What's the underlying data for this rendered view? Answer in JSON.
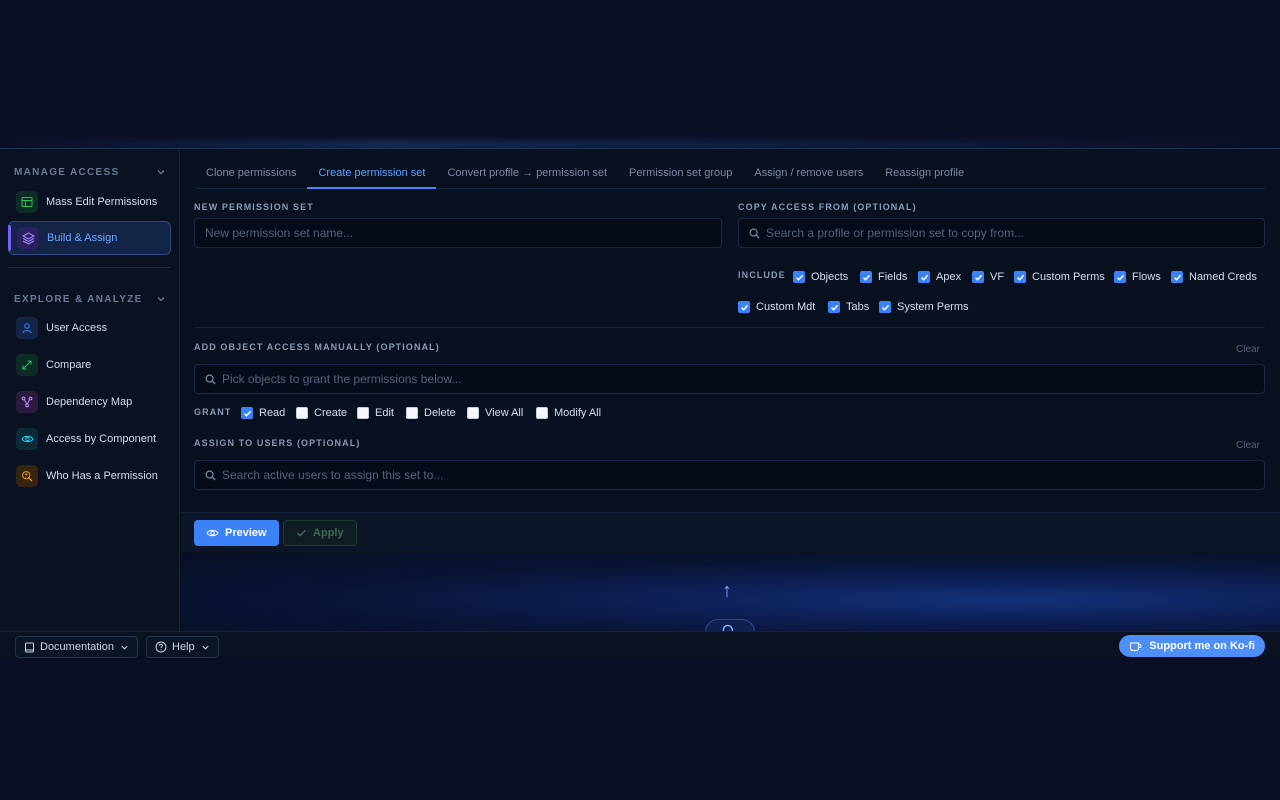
{
  "sidebar": {
    "manage_access_title": "MANAGE ACCESS",
    "explore_title": "EXPLORE & ANALYZE",
    "items": [
      {
        "label": "Mass Edit Permissions",
        "icon": "table-icon",
        "color": "#22c55e"
      },
      {
        "label": "Build & Assign",
        "icon": "layers-icon",
        "color": "#a78bfa"
      },
      {
        "label": "User Access",
        "icon": "user-icon",
        "color": "#3b82f6"
      },
      {
        "label": "Compare",
        "icon": "compare-arrows-icon",
        "color": "#22c55e"
      },
      {
        "label": "Dependency Map",
        "icon": "graph-icon",
        "color": "#c084fc"
      },
      {
        "label": "Access by Component",
        "icon": "eye-icon",
        "color": "#22d3ee"
      },
      {
        "label": "Who Has a Permission",
        "icon": "search-person-icon",
        "color": "#f59e0b"
      }
    ]
  },
  "tabs": [
    {
      "label": "Clone permissions"
    },
    {
      "label": "Create permission set"
    },
    {
      "label": "Convert profile → permission set"
    },
    {
      "label": "Permission set group"
    },
    {
      "label": "Assign / remove users"
    },
    {
      "label": "Reassign profile"
    }
  ],
  "form": {
    "new_set_label": "NEW PERMISSION SET",
    "new_set_placeholder": "New permission set name...",
    "copy_label": "COPY ACCESS FROM (OPTIONAL)",
    "copy_placeholder": "Search a profile or permission set to copy from...",
    "include_label": "INCLUDE",
    "include_options": [
      {
        "label": "Objects",
        "checked": true
      },
      {
        "label": "Fields",
        "checked": true
      },
      {
        "label": "Apex",
        "checked": true
      },
      {
        "label": "VF",
        "checked": true
      },
      {
        "label": "Custom Perms",
        "checked": true
      },
      {
        "label": "Flows",
        "checked": true
      },
      {
        "label": "Named Creds",
        "checked": true
      },
      {
        "label": "Custom Mdt",
        "checked": true
      },
      {
        "label": "Tabs",
        "checked": true
      },
      {
        "label": "System Perms",
        "checked": true
      }
    ],
    "object_access_label": "ADD OBJECT ACCESS MANUALLY (OPTIONAL)",
    "object_placeholder": "Pick objects to grant the permissions below...",
    "clear": "Clear",
    "grant_label": "GRANT",
    "grant_options": [
      {
        "label": "Read",
        "checked": true
      },
      {
        "label": "Create",
        "checked": false
      },
      {
        "label": "Edit",
        "checked": false
      },
      {
        "label": "Delete",
        "checked": false
      },
      {
        "label": "View All",
        "checked": false
      },
      {
        "label": "Modify All",
        "checked": false
      }
    ],
    "assign_label": "ASSIGN TO USERS (OPTIONAL)",
    "assign_placeholder": "Search active users to assign this set to..."
  },
  "actions": {
    "preview": "Preview",
    "apply": "Apply"
  },
  "lower": {
    "arrow": "↑"
  },
  "bottom": {
    "documentation": "Documentation",
    "help": "Help",
    "kofi": "Support me on Ko-fi"
  },
  "colors": {
    "accent": "#3b82f6",
    "background": "#0b0f26"
  }
}
